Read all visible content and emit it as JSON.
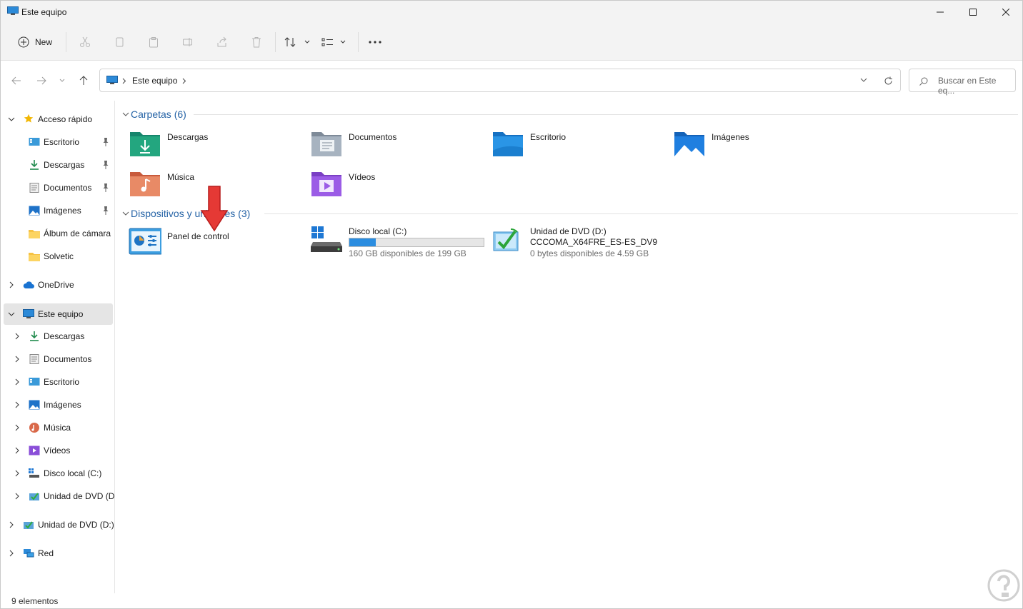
{
  "window": {
    "title": "Este equipo",
    "controls": {
      "minimize": "minimize-icon",
      "maximize": "maximize-icon",
      "close": "close-icon"
    }
  },
  "toolbar": {
    "new_label": "New",
    "icons": [
      "cut-icon",
      "copy-icon",
      "paste-icon",
      "rename-icon",
      "share-icon",
      "delete-icon",
      "sort-icon",
      "view-icon",
      "more-icon"
    ]
  },
  "address": {
    "path": [
      "Este equipo"
    ],
    "search_placeholder": "Buscar en Este eq..."
  },
  "sidebar": {
    "quick_access": {
      "label": "Acceso rápido",
      "items": [
        {
          "label": "Escritorio",
          "pinned": true
        },
        {
          "label": "Descargas",
          "pinned": true
        },
        {
          "label": "Documentos",
          "pinned": true
        },
        {
          "label": "Imágenes",
          "pinned": true
        },
        {
          "label": "Álbum de cámara",
          "pinned": false
        },
        {
          "label": "Solvetic",
          "pinned": false
        }
      ]
    },
    "onedrive": {
      "label": "OneDrive"
    },
    "this_pc": {
      "label": "Este equipo",
      "items": [
        {
          "label": "Descargas"
        },
        {
          "label": "Documentos"
        },
        {
          "label": "Escritorio"
        },
        {
          "label": "Imágenes"
        },
        {
          "label": "Música"
        },
        {
          "label": "Vídeos"
        },
        {
          "label": "Disco local (C:)"
        },
        {
          "label": "Unidad de DVD (D:"
        }
      ]
    },
    "dvd": {
      "label": "Unidad de DVD (D:)"
    },
    "network": {
      "label": "Red"
    }
  },
  "main": {
    "folders_group": {
      "title": "Carpetas (6)"
    },
    "folders": [
      {
        "name": "Descargas"
      },
      {
        "name": "Documentos"
      },
      {
        "name": "Escritorio"
      },
      {
        "name": "Imágenes"
      },
      {
        "name": "Música"
      },
      {
        "name": "Vídeos"
      }
    ],
    "devices_group": {
      "title": "Dispositivos y unidades (3)"
    },
    "devices": [
      {
        "name": "Panel de control"
      },
      {
        "name": "Disco local (C:)",
        "free_text": "160 GB disponibles de 199 GB",
        "used_fraction": 0.196
      },
      {
        "name": "Unidad de DVD (D:)",
        "volume": "CCCOMA_X64FRE_ES-ES_DV9",
        "free_text": "0 bytes disponibles de 4.59 GB"
      }
    ]
  },
  "status": {
    "count": "9 elementos"
  },
  "colors": {
    "accent": "#2563a6",
    "selected_bg": "#e5e5e5",
    "annotation_arrow": "#e53935"
  }
}
